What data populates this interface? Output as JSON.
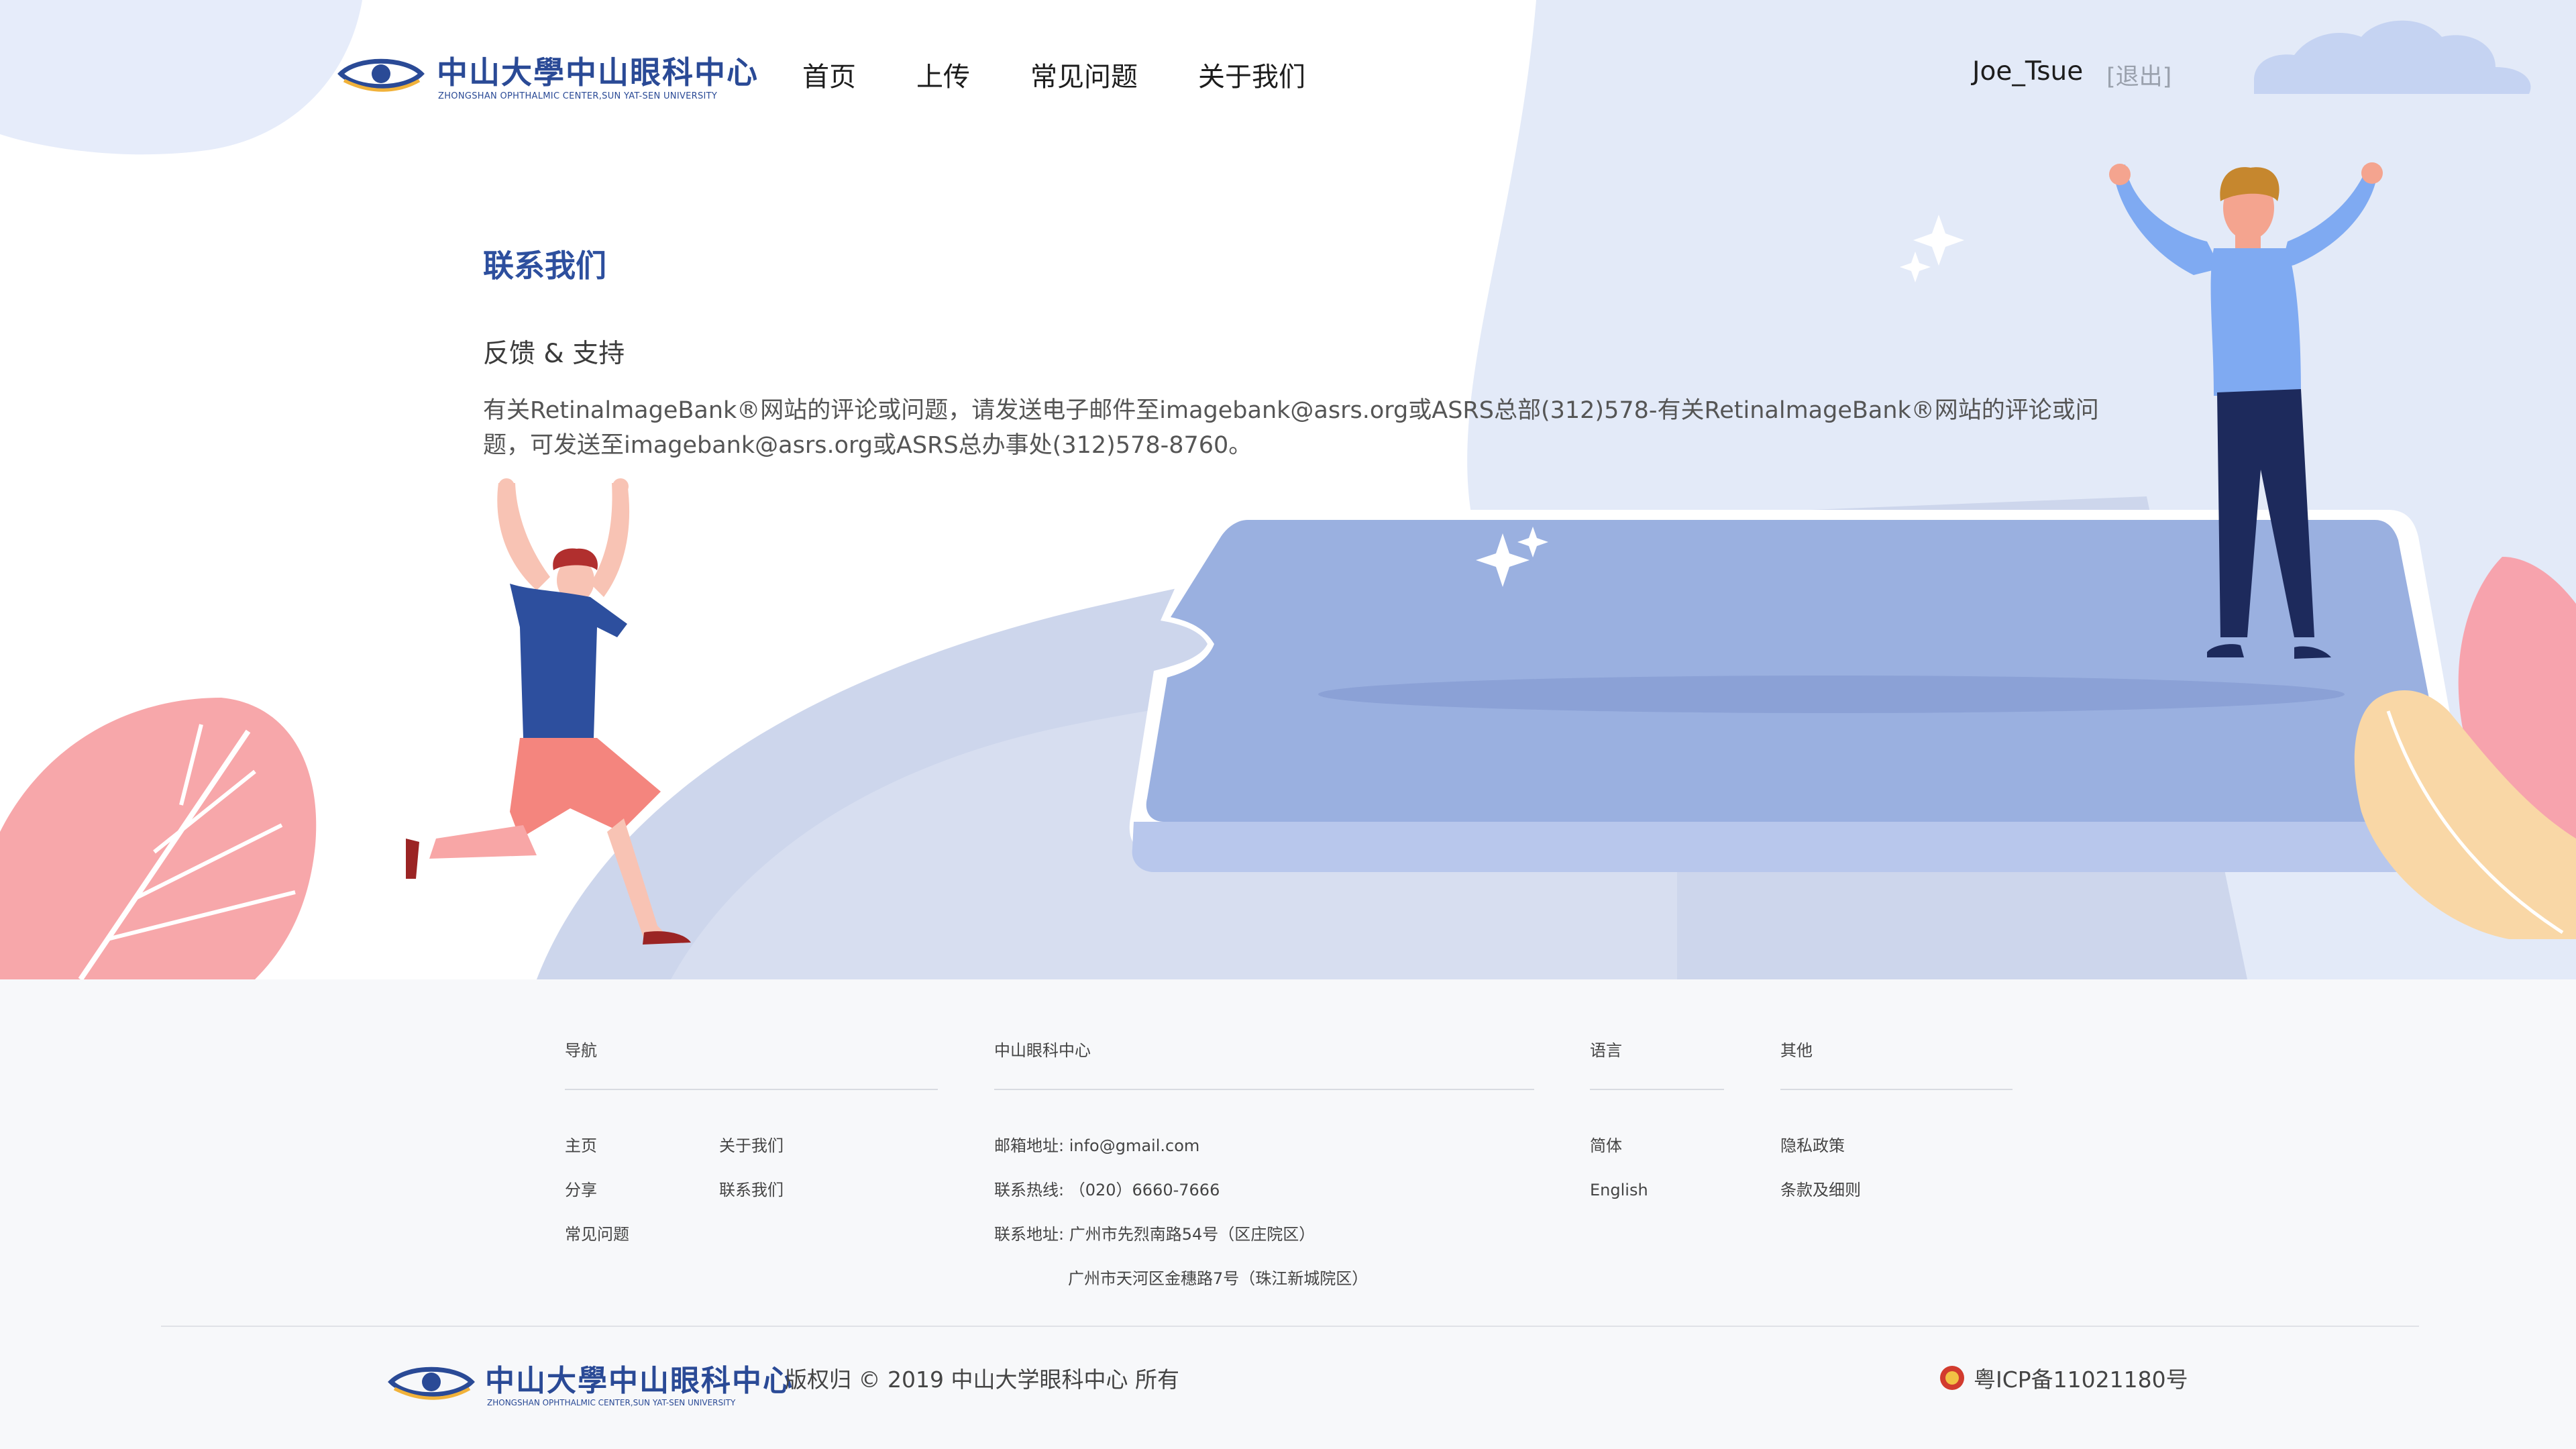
{
  "header": {
    "logo_cn": "中山大學中山眼科中心",
    "logo_en": "ZHONGSHAN OPHTHALMIC CENTER,SUN YAT-SEN UNIVERSITY",
    "nav": [
      "首页",
      "上传",
      "常见问题",
      "关于我们"
    ],
    "username": "Joe_Tsue",
    "logout": "[退出]"
  },
  "contact": {
    "title": "联系我们",
    "subtitle": "反馈 & 支持",
    "body": "有关RetinalmageBank®网站的评论或问题，请发送电子邮件至imagebank@asrs.org或ASRS总部(312)578-有关RetinalmageBank®网站的评论或问题，可发送至imagebank@asrs.org或ASRS总办事处(312)578-8760。"
  },
  "footer": {
    "nav": {
      "title": "导航",
      "items": [
        "主页",
        "关于我们",
        "分享",
        "联系我们",
        "常见问题"
      ]
    },
    "center": {
      "title": "中山眼科中心",
      "items": [
        "邮箱地址: info@gmail.com",
        "联系热线: （020）6660-7666",
        "联系地址: 广州市先烈南路54号（区庄院区）",
        "广州市天河区金穗路7号（珠江新城院区）"
      ]
    },
    "language": {
      "title": "语言",
      "items": [
        "简体",
        "English"
      ]
    },
    "other": {
      "title": "其他",
      "items": [
        "隐私政策",
        "条款及细则"
      ]
    },
    "logo_cn": "中山大學中山眼科中心",
    "logo_en": "ZHONGSHAN OPHTHALMIC CENTER,SUN YAT-SEN UNIVERSITY",
    "copyright": "版权归 © 2019  中山大学眼科中心 所有",
    "icp": "粤ICP备11021180号"
  },
  "colors": {
    "brand": "#2a4a96",
    "title": "#2d4f9e",
    "platform": "#9ab0e0",
    "blob": "#dfe7f7"
  }
}
